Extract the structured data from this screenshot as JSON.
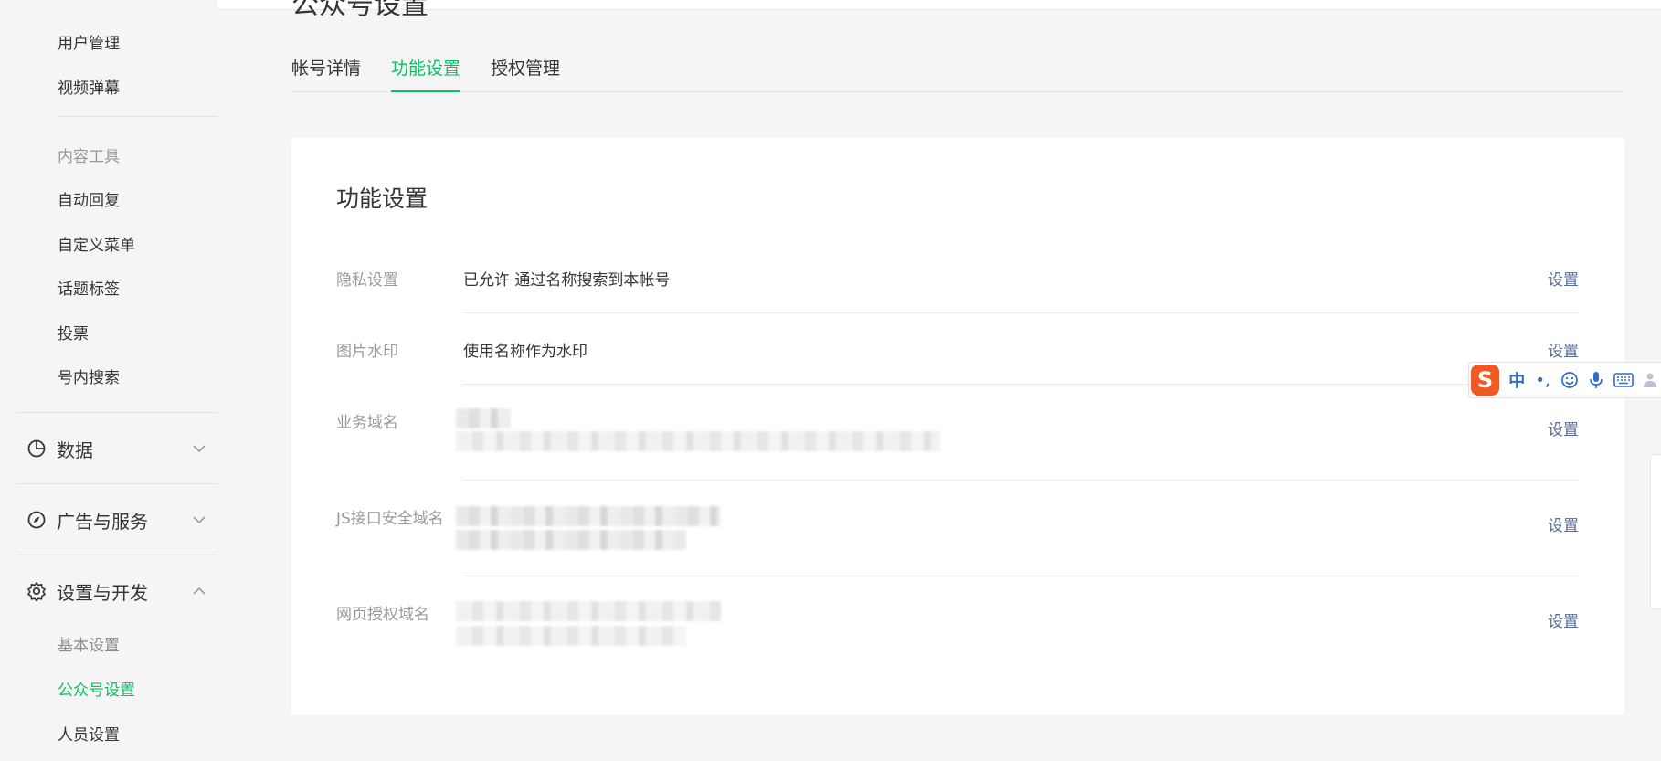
{
  "page": {
    "title": "公众号设置"
  },
  "sidebar": {
    "top_items": [
      "用户管理",
      "视频弹幕"
    ],
    "section_content_tools": "内容工具",
    "content_items": [
      "自动回复",
      "自定义菜单",
      "话题标签",
      "投票",
      "号内搜索"
    ],
    "groups": {
      "data": "数据",
      "ads": "广告与服务",
      "settings": "设置与开发"
    },
    "settings_items": [
      "基本设置",
      "公众号设置",
      "人员设置"
    ]
  },
  "tabs": [
    "帐号详情",
    "功能设置",
    "授权管理"
  ],
  "card": {
    "title": "功能设置",
    "rows": [
      {
        "label": "隐私设置",
        "value": "已允许 通过名称搜索到本帐号",
        "action": "设置"
      },
      {
        "label": "图片水印",
        "value": "使用名称作为水印",
        "action": "设置"
      },
      {
        "label": "业务域名",
        "value": "",
        "action": "设置"
      },
      {
        "label": "JS接口安全域名",
        "value": "",
        "action": "设置"
      },
      {
        "label": "网页授权域名",
        "value": "",
        "action": "设置"
      }
    ]
  },
  "ime": {
    "logo": "S",
    "mode": "中",
    "punct": "•,",
    "icons": [
      "emoji-icon",
      "microphone-icon",
      "keyboard-icon",
      "user-icon"
    ]
  },
  "colors": {
    "accent": "#07c160",
    "link": "#576b95",
    "muted": "#9a9a9a",
    "ime_brand": "#f15a22"
  }
}
